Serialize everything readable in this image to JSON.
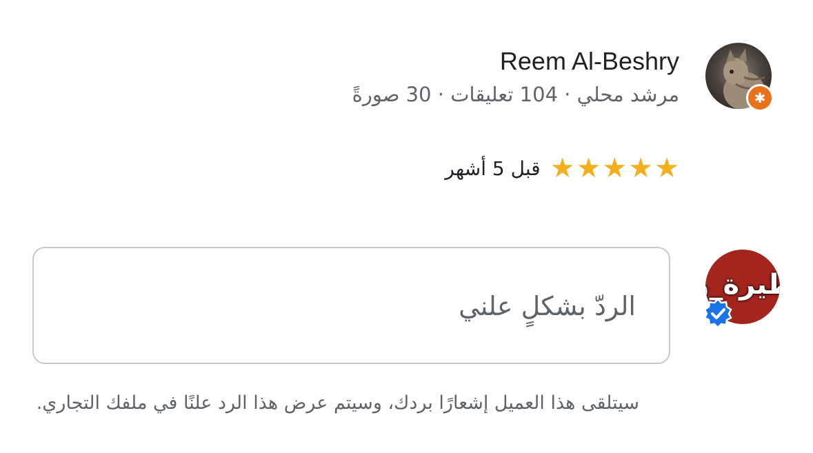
{
  "review": {
    "reviewer_name": "Reem Al-Beshry",
    "reviewer_meta": "مرشد محلي · 104 تعليقات · 30 صورةً",
    "rating": 5,
    "rating_max": 5,
    "time_ago": "قبل 5 أشهر",
    "avatar_icon": "cat-photo-avatar",
    "badge_icon": "local-guide-star-icon",
    "star_color": "#f2b01e"
  },
  "owner": {
    "avatar_text": "ظيرة_وذ",
    "avatar_color": "#a4251d",
    "verified_icon": "verified-check-icon",
    "verified_color": "#1a73e8"
  },
  "reply": {
    "placeholder": "الردّ بشكلٍ علني",
    "helper_text": "سيتلقى هذا العميل إشعارًا بردك، وسيتم عرض هذا الرد علنًا في ملفك التجاري."
  }
}
